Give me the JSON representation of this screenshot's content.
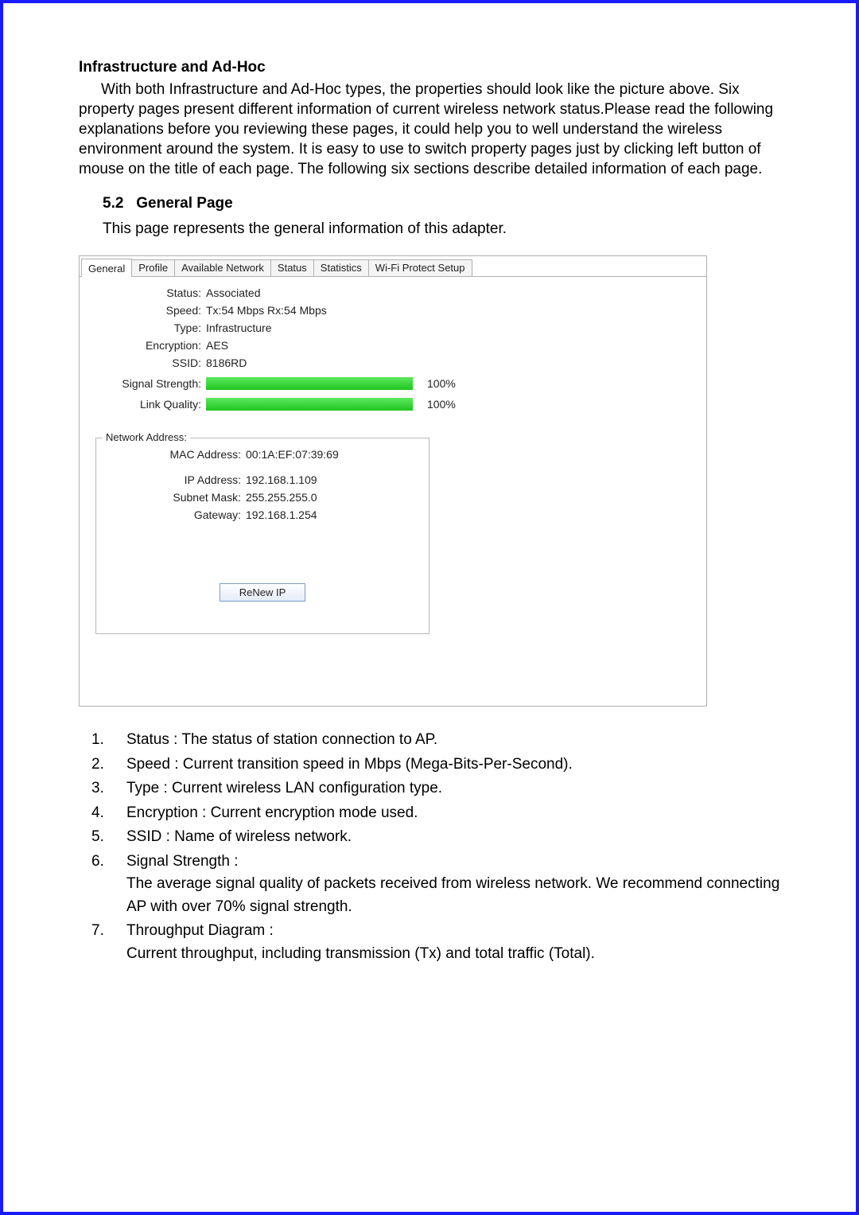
{
  "text": {
    "heading1": "Infrastructure and Ad-Hoc",
    "para1": "With both Infrastructure and Ad-Hoc types, the properties should look like the picture above. Six property pages present different information of current wireless network status.Please read the following explanations before you reviewing these pages, it could help you to well understand the wireless environment around the system. It is easy to use to switch property pages just by clicking left button of mouse on the title of each page. The following six sections describe detailed information of each page.",
    "subsection_no": "5.2",
    "subsection_title": "General Page",
    "subsection_intro": "This page represents the general information of this adapter."
  },
  "tabs": {
    "general": "General",
    "profile": "Profile",
    "available_network": "Available Network",
    "status": "Status",
    "statistics": "Statistics",
    "wps": "Wi-Fi Protect Setup"
  },
  "general": {
    "status_label": "Status:",
    "status_value": "Associated",
    "speed_label": "Speed:",
    "speed_value": "Tx:54 Mbps Rx:54 Mbps",
    "type_label": "Type:",
    "type_value": "Infrastructure",
    "encryption_label": "Encryption:",
    "encryption_value": "AES",
    "ssid_label": "SSID:",
    "ssid_value": "8186RD",
    "signal_label": "Signal Strength:",
    "signal_pct": "100%",
    "link_label": "Link Quality:",
    "link_pct": "100%",
    "fieldset_legend": "Network Address:",
    "mac_label": "MAC Address:",
    "mac_value": "00:1A:EF:07:39:69",
    "ip_label": "IP Address:",
    "ip_value": "192.168.1.109",
    "subnet_label": "Subnet Mask:",
    "subnet_value": "255.255.255.0",
    "gateway_label": "Gateway:",
    "gateway_value": "192.168.1.254",
    "renew_btn": "ReNew IP"
  },
  "list": {
    "i1": "Status : The status of station connection to AP.",
    "i2": "Speed : Current transition speed in Mbps (Mega-Bits-Per-Second).",
    "i3": "Type : Current wireless LAN configuration type.",
    "i4": "Encryption : Current encryption mode used.",
    "i5": "SSID : Name of wireless network.",
    "i6a": "Signal Strength :",
    "i6b": "The average signal quality of packets received from wireless network. We recommend connecting AP with over 70% signal strength.",
    "i7a": "Throughput Diagram :",
    "i7b": "Current throughput, including transmission (Tx) and total traffic (Total)."
  },
  "chart_data": {
    "type": "bar",
    "series": [
      {
        "name": "Signal Strength",
        "value": 100
      },
      {
        "name": "Link Quality",
        "value": 100
      }
    ],
    "unit": "%",
    "range": [
      0,
      100
    ]
  }
}
